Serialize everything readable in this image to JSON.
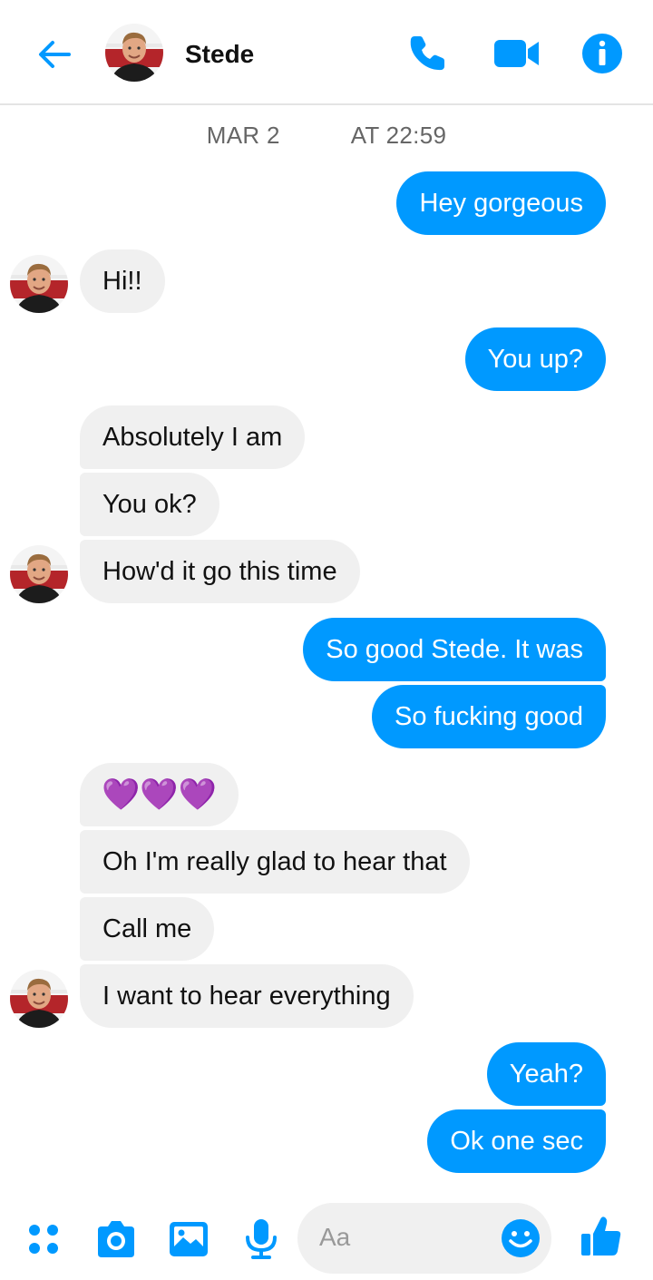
{
  "header": {
    "contact_name": "Stede",
    "back_icon": "back-arrow-icon",
    "call_icon": "phone-icon",
    "video_icon": "video-camera-icon",
    "info_icon": "info-icon"
  },
  "conversation": {
    "timestamp_date": "MAR 2",
    "timestamp_time": "AT 22:59",
    "messages": [
      {
        "sender": "me",
        "text": "Hey gorgeous"
      },
      {
        "sender": "Stede",
        "text": "Hi!!"
      },
      {
        "sender": "me",
        "text": "You up?"
      },
      {
        "sender": "Stede",
        "text": "Absolutely I am"
      },
      {
        "sender": "Stede",
        "text": "You ok?"
      },
      {
        "sender": "Stede",
        "text": "How'd it go this time"
      },
      {
        "sender": "me",
        "text": "So good Stede. It was"
      },
      {
        "sender": "me",
        "text": "So fucking good"
      },
      {
        "sender": "Stede",
        "text": "💜💜💜"
      },
      {
        "sender": "Stede",
        "text": "Oh I'm really glad to hear that"
      },
      {
        "sender": "Stede",
        "text": "Call me"
      },
      {
        "sender": "Stede",
        "text": "I want to hear everything"
      },
      {
        "sender": "me",
        "text": "Yeah?"
      },
      {
        "sender": "me",
        "text": "Ok one sec"
      }
    ]
  },
  "composer": {
    "placeholder": "Aa",
    "icons": [
      "apps-menu-icon",
      "camera-icon",
      "image-gallery-icon",
      "microphone-icon",
      "emoji-icon",
      "thumbs-up-icon"
    ]
  },
  "colors": {
    "accent": "#0099ff",
    "incoming_bubble": "#f0f0f0",
    "outgoing_text": "#ffffff",
    "incoming_text": "#111111",
    "heart": "#8a2be2"
  }
}
